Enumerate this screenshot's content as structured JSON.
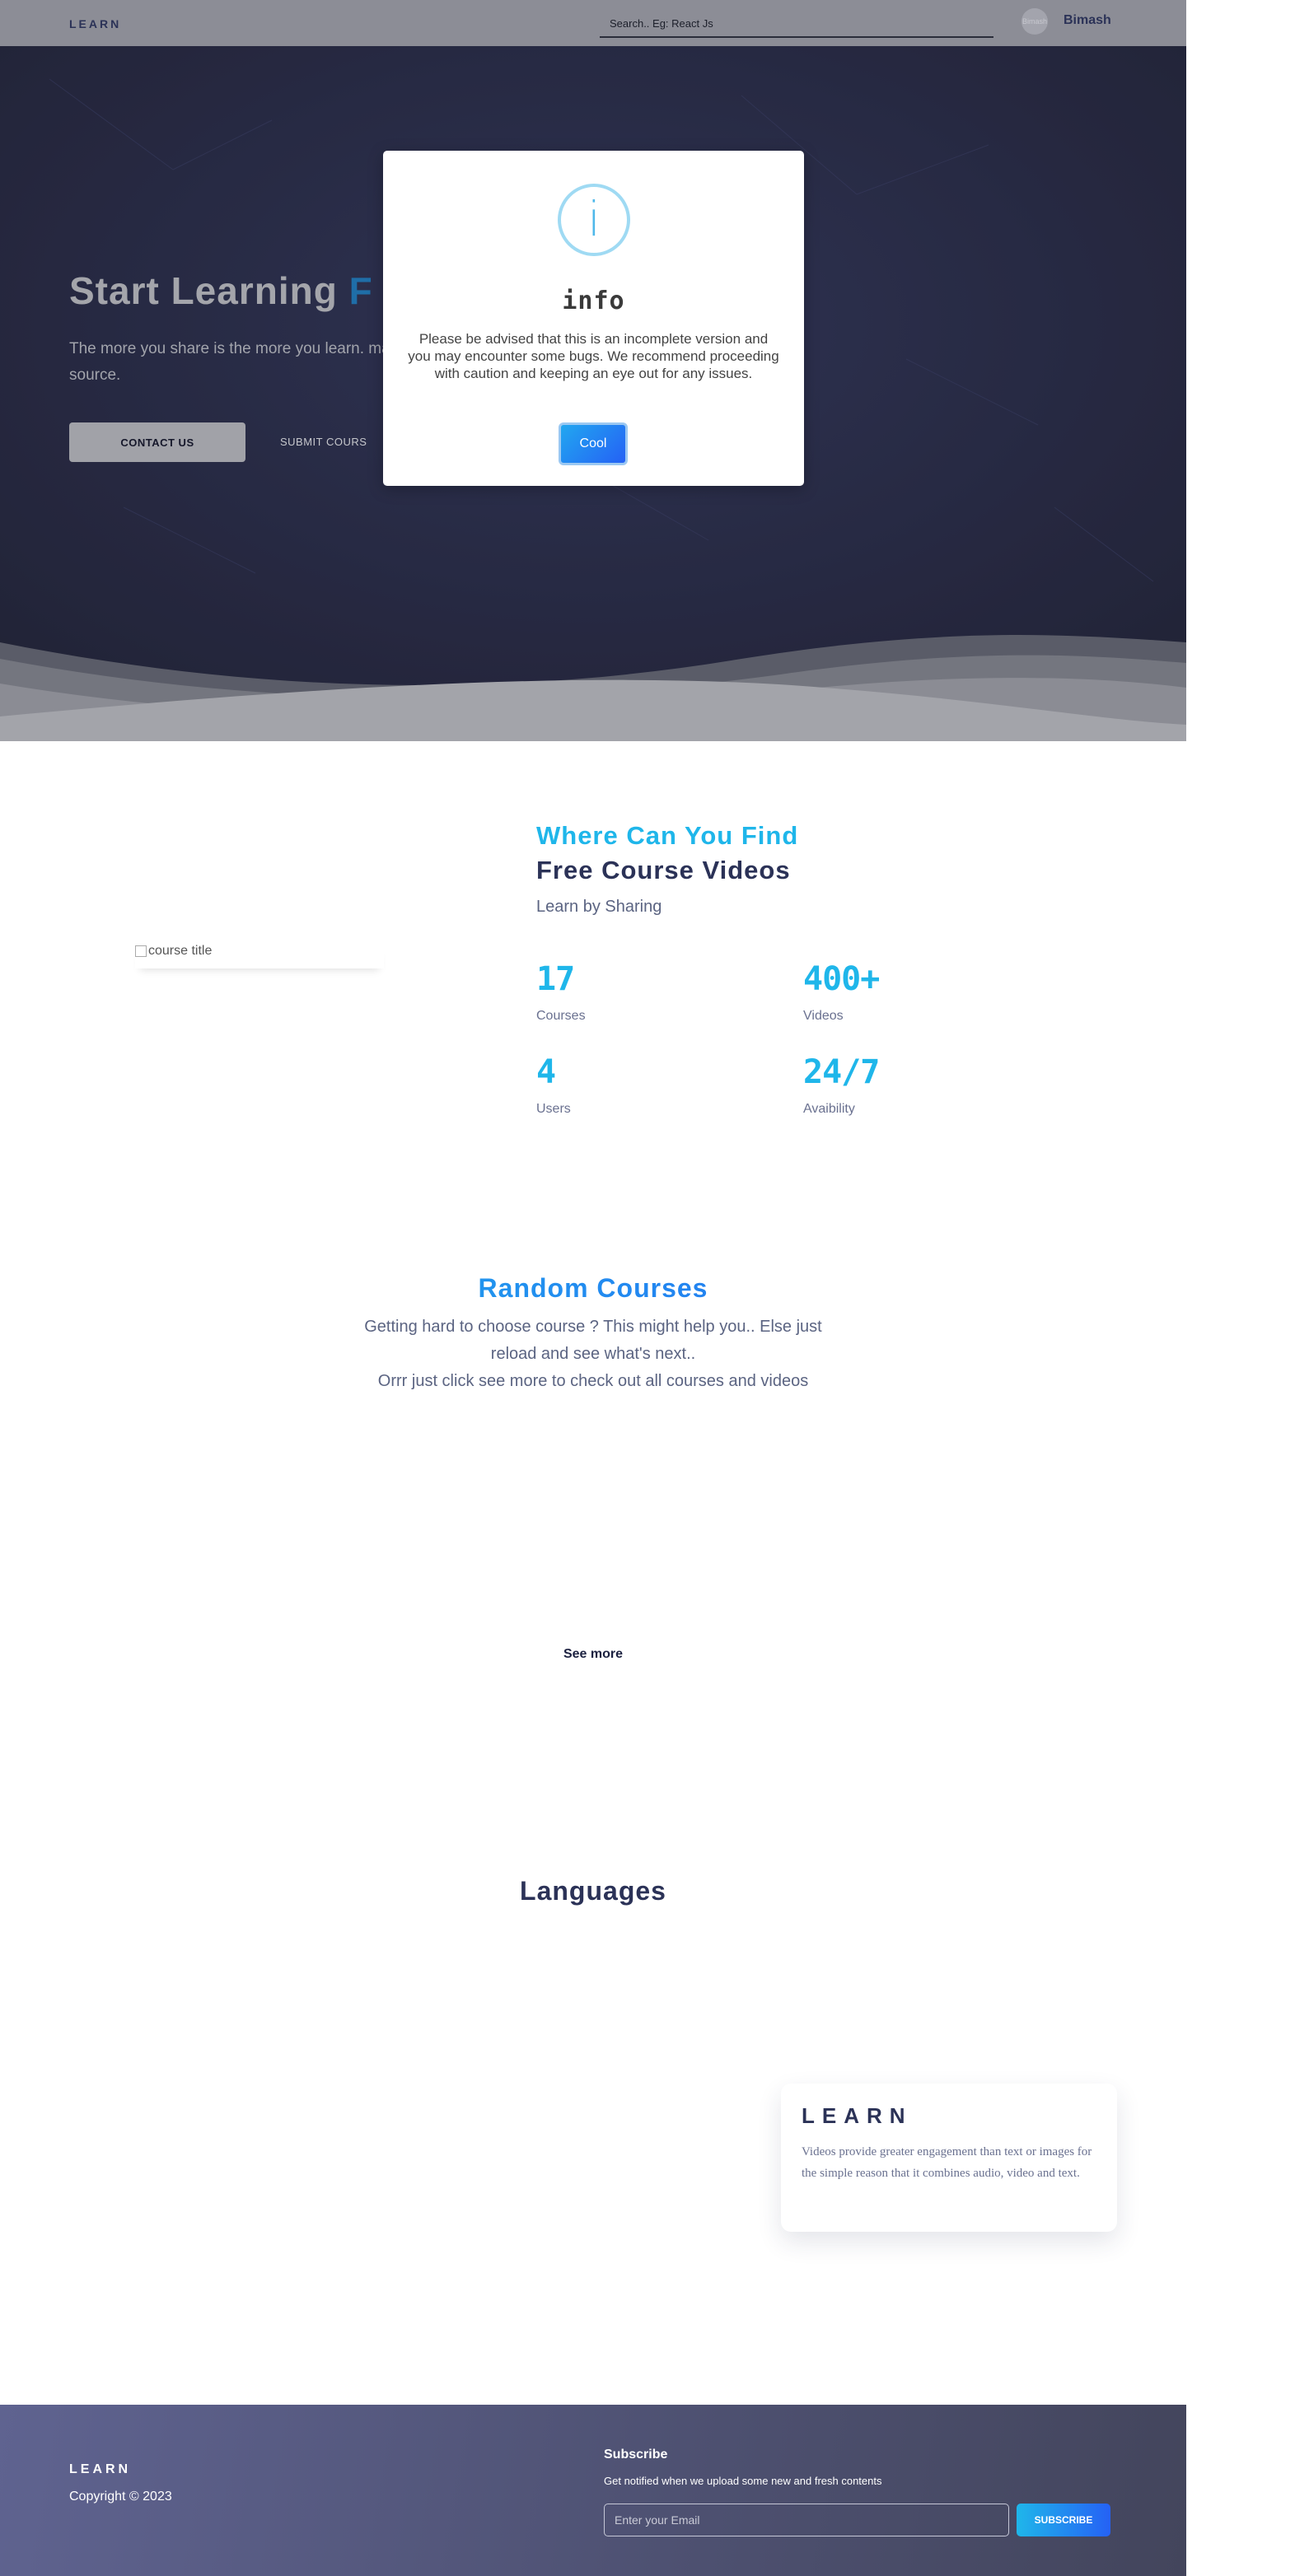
{
  "nav": {
    "brand": "LEARN",
    "search_placeholder": "Search.. Eg: React Js",
    "avatar_alt": "Bimash",
    "user_name": "Bimash"
  },
  "hero": {
    "title_main": "Start Learning ",
    "title_accent": "F",
    "subtitle": "The more you share is the more you learn. many source.",
    "contact_label": "CONTACT US",
    "submit_label": "SUBMIT COURS"
  },
  "modal": {
    "icon": "info-icon",
    "icon_glyph": "i",
    "title": "info",
    "message": "Please be advised that this is an incomplete version and you may encounter some bugs. We recommend proceeding with caution and keeping an eye out for any issues.",
    "button_label": "Cool"
  },
  "about": {
    "image_alt": "course title",
    "title_line1": "Where Can You Find",
    "title_line2": "Free Course Videos",
    "subtitle": "Learn by Sharing",
    "stats": [
      {
        "value": "17",
        "label": "Courses"
      },
      {
        "value": "400+",
        "label": "Videos"
      },
      {
        "value": "4",
        "label": "Users"
      },
      {
        "value": "24/7",
        "label": "Avaibility"
      }
    ]
  },
  "random": {
    "title": "Random Courses",
    "line1": "Getting hard to choose course ? This might help you.. Else just reload and see what's next..",
    "line2": "Orrr just click see more to check out all courses and videos",
    "see_more": "See more"
  },
  "languages": {
    "title": "Languages"
  },
  "learn_card": {
    "title": "LEARN",
    "text": "Videos provide greater engagement than text or images for the simple reason that it combines audio, video and text."
  },
  "footer": {
    "brand": "LEARN",
    "copyright": "Copyright © 2023",
    "subscribe_title": "Subscribe",
    "subscribe_text": "Get notified when we upload some new and fresh contents",
    "email_placeholder": "Enter your Email",
    "subscribe_button": "SUBSCRIBE"
  },
  "colors": {
    "accent": "#1fb6ea",
    "accent_blue": "#2561f5",
    "navy": "#2b3257",
    "hero_bg": "#181b33"
  }
}
